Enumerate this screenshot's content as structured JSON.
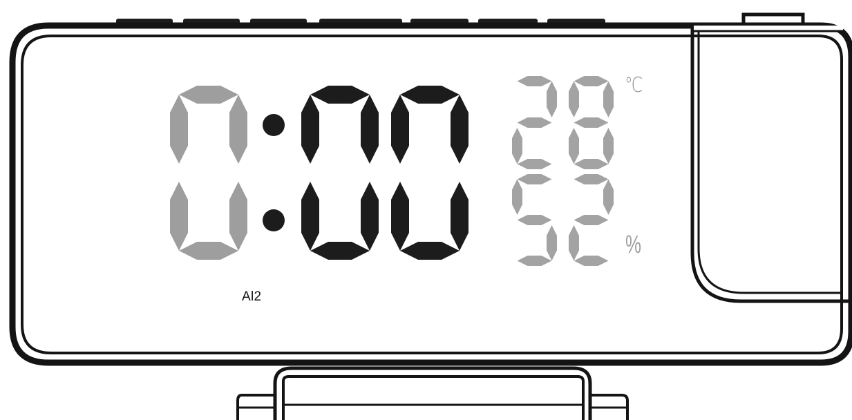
{
  "time": {
    "digits": [
      "0",
      "0",
      "0"
    ],
    "digit_states": [
      "dim",
      "active",
      "active"
    ],
    "colon": ":"
  },
  "temperature": {
    "digits": [
      "2",
      "8"
    ],
    "unit": "℃"
  },
  "humidity": {
    "digits": [
      "5",
      "2"
    ],
    "unit": "%"
  },
  "alarm_indicator": "Al2",
  "colors": {
    "segment_active": "#1c1c1c",
    "segment_dim": "#9e9e9e",
    "side_segment": "#a3a3a3",
    "outline": "#141414"
  },
  "icons": [
    "projector-lens-icon",
    "colon-dot-icon"
  ]
}
